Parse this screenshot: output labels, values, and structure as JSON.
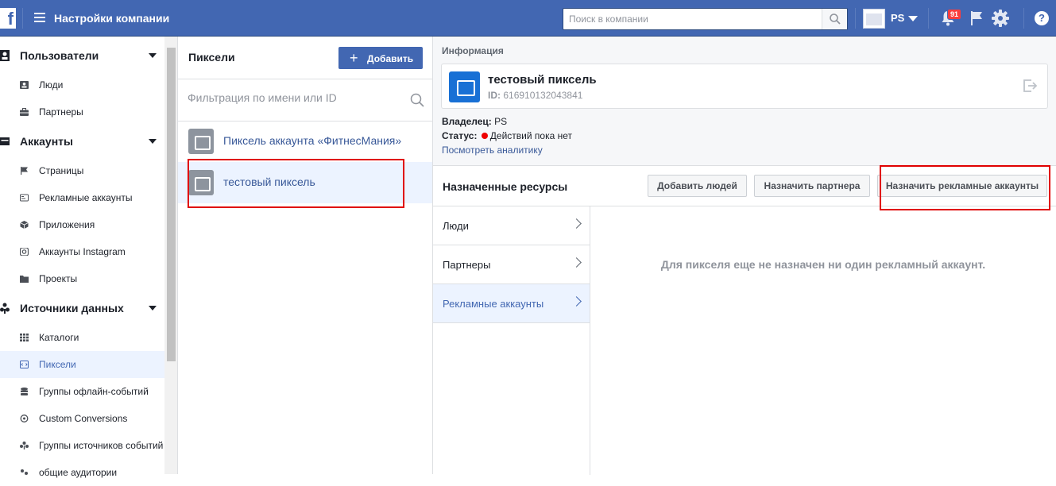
{
  "header": {
    "logo": "f",
    "title": "Настройки компании",
    "search_placeholder": "Поиск в компании",
    "business_name": "PS",
    "notifications_count": "91",
    "help": "?"
  },
  "sidebar": {
    "groups": [
      {
        "label": "Пользователи",
        "items": [
          "Люди",
          "Партнеры"
        ]
      },
      {
        "label": "Аккаунты",
        "items": [
          "Страницы",
          "Рекламные аккаунты",
          "Приложения",
          "Аккаунты Instagram",
          "Проекты"
        ]
      },
      {
        "label": "Источники данных",
        "items": [
          "Каталоги",
          "Пиксели",
          "Группы офлайн-событий",
          "Custom Conversions",
          "Группы источников событий",
          "общие аудитории"
        ]
      }
    ],
    "active_item": "Пиксели"
  },
  "pixels_panel": {
    "title": "Пиксели",
    "add_label": "Добавить",
    "filter_placeholder": "Фильтрация по имени или ID",
    "items": [
      "Пиксель аккаунта «ФитнесМания»",
      "тестовый пиксель"
    ],
    "selected_index": 1
  },
  "info": {
    "section_label": "Информация",
    "name": "тестовый пиксель",
    "id_label": "ID:",
    "id_value": "616910132043841",
    "owner_label": "Владелец:",
    "owner_value": "PS",
    "status_label": "Статус:",
    "status_value": "Действий пока нет",
    "analytics_link": "Посмотреть аналитику"
  },
  "assigned": {
    "title": "Назначенные ресурсы",
    "buttons": [
      "Добавить людей",
      "Назначить партнера",
      "Назначить рекламные аккаунты"
    ],
    "tabs": [
      "Люди",
      "Партнеры",
      "Рекламные аккаунты"
    ],
    "active_tab": 2,
    "empty_message": "Для пикселя еще не назначен ни один рекламный аккаунт."
  },
  "colors": {
    "brand": "#4267b2",
    "highlight_box": "#e00000",
    "selected_bg": "#ecf3ff"
  }
}
